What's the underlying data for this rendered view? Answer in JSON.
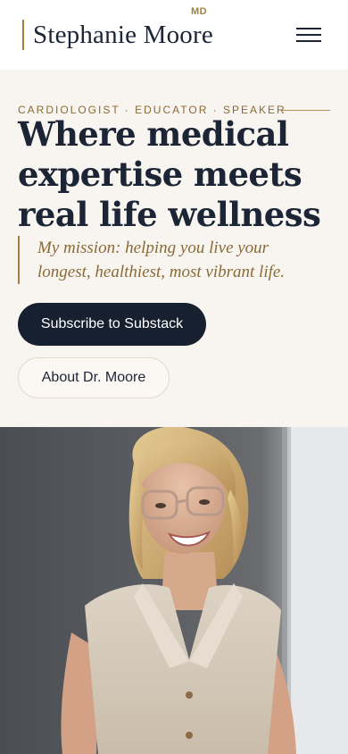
{
  "header": {
    "brand_name": "Stephanie Moore",
    "brand_suffix": "MD",
    "menu_icon": "hamburger-menu-icon"
  },
  "hero": {
    "eyebrow": "CARDIOLOGIST · EDUCATOR · SPEAKER",
    "headline_line1": "Where medical",
    "headline_line2": "expertise meets",
    "headline_line3": "real life wellness",
    "mission_line1": "My mission: helping you live your",
    "mission_line2": "longest, healthiest, most vibrant life.",
    "primary_button": "Subscribe to Substack",
    "secondary_button": "About Dr. Moore"
  },
  "colors": {
    "accent_gold": "#a57f3f",
    "navy": "#16202e",
    "hero_background": "#f8f4ef"
  }
}
